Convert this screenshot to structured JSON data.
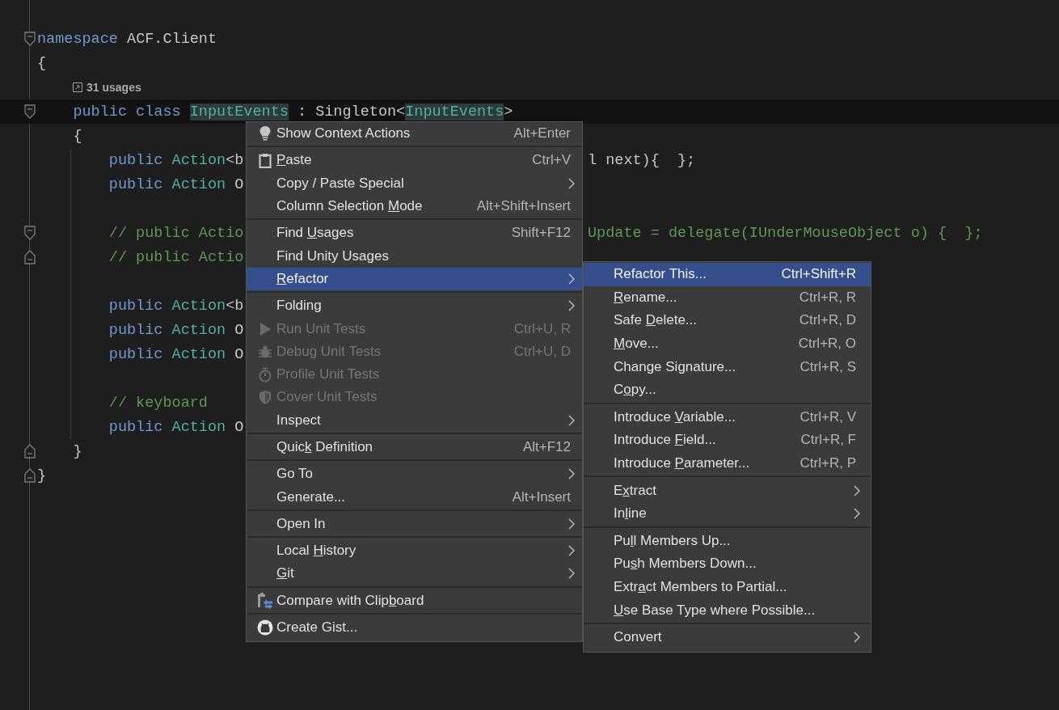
{
  "editor": {
    "lines": [
      {
        "kind": "code",
        "fold_start": true,
        "fold_end": false,
        "current": false,
        "left": [
          {
            "t": "namespace",
            "kind": "keyword"
          },
          {
            "t": " ACF.Client",
            "kind": "plain"
          }
        ]
      },
      {
        "kind": "code",
        "fold_start": false,
        "fold_end": false,
        "current": false,
        "left": [
          {
            "t": "{",
            "kind": "plain"
          }
        ]
      },
      {
        "kind": "lens",
        "text": "31 usages"
      },
      {
        "kind": "code",
        "fold_start": true,
        "fold_end": false,
        "current": true,
        "left": [
          {
            "t": "    public class ",
            "kind": "keyword"
          },
          {
            "t": "InputEvents",
            "kind": "type-highlight"
          },
          {
            "t": " : Singleton<",
            "kind": "plain"
          },
          {
            "t": "InputEvents",
            "kind": "type-highlight"
          },
          {
            "t": ">",
            "kind": "plain"
          }
        ]
      },
      {
        "kind": "code",
        "fold_start": false,
        "fold_end": false,
        "current": false,
        "left": [
          {
            "t": "    {",
            "kind": "plain"
          }
        ]
      },
      {
        "kind": "code",
        "fold_start": false,
        "fold_end": false,
        "current": false,
        "left": [
          {
            "t": "        public ",
            "kind": "keyword"
          },
          {
            "t": "Action",
            "kind": "type"
          },
          {
            "t": "<b",
            "kind": "plain"
          }
        ],
        "right": [
          {
            "t": "l next){  };",
            "kind": "plain"
          }
        ]
      },
      {
        "kind": "code",
        "fold_start": false,
        "fold_end": false,
        "current": false,
        "left": [
          {
            "t": "        public ",
            "kind": "keyword"
          },
          {
            "t": "Action",
            "kind": "type"
          },
          {
            "t": " O",
            "kind": "plain"
          }
        ]
      },
      {
        "kind": "blank"
      },
      {
        "kind": "code",
        "fold_start": true,
        "fold_end": false,
        "current": false,
        "left": [
          {
            "t": "        // public Actio",
            "kind": "comment"
          }
        ],
        "right": [
          {
            "t": "Update = delegate(IUnderMouseObject o) {  };",
            "kind": "comment"
          }
        ]
      },
      {
        "kind": "code",
        "fold_start": false,
        "fold_end": true,
        "current": false,
        "left": [
          {
            "t": "        // public Actio",
            "kind": "comment"
          }
        ]
      },
      {
        "kind": "blank"
      },
      {
        "kind": "code",
        "fold_start": false,
        "fold_end": false,
        "current": false,
        "left": [
          {
            "t": "        public ",
            "kind": "keyword"
          },
          {
            "t": "Action",
            "kind": "type"
          },
          {
            "t": "<b",
            "kind": "plain"
          }
        ]
      },
      {
        "kind": "code",
        "fold_start": false,
        "fold_end": false,
        "current": false,
        "left": [
          {
            "t": "        public ",
            "kind": "keyword"
          },
          {
            "t": "Action",
            "kind": "type"
          },
          {
            "t": " O",
            "kind": "plain"
          }
        ]
      },
      {
        "kind": "code",
        "fold_start": false,
        "fold_end": false,
        "current": false,
        "left": [
          {
            "t": "        public ",
            "kind": "keyword"
          },
          {
            "t": "Action",
            "kind": "type"
          },
          {
            "t": " O",
            "kind": "plain"
          }
        ]
      },
      {
        "kind": "blank"
      },
      {
        "kind": "code",
        "fold_start": false,
        "fold_end": false,
        "current": false,
        "left": [
          {
            "t": "        // keyboard",
            "kind": "comment"
          }
        ]
      },
      {
        "kind": "code",
        "fold_start": false,
        "fold_end": false,
        "current": false,
        "left": [
          {
            "t": "        public ",
            "kind": "keyword"
          },
          {
            "t": "Action",
            "kind": "type"
          },
          {
            "t": " O",
            "kind": "plain"
          }
        ]
      },
      {
        "kind": "code",
        "fold_start": false,
        "fold_end": true,
        "current": false,
        "left": [
          {
            "t": "    }",
            "kind": "plain"
          }
        ]
      },
      {
        "kind": "code",
        "fold_start": false,
        "fold_end": true,
        "current": false,
        "left": [
          {
            "t": "}",
            "kind": "plain"
          }
        ]
      }
    ]
  },
  "context_menu": {
    "groups": [
      [
        {
          "label": "Show Context Actions",
          "shortcut": "Alt+Enter",
          "has_submenu": false,
          "disabled": false,
          "selected": false
        }
      ],
      [
        {
          "mnemonic": "P",
          "label_after": "aste",
          "shortcut": "Ctrl+V",
          "has_submenu": false,
          "disabled": false,
          "selected": false
        },
        {
          "label": "Copy / Paste Special",
          "has_submenu": true,
          "disabled": false,
          "selected": false
        },
        {
          "label_before": "Column Selection ",
          "mnemonic": "M",
          "label_after": "ode",
          "shortcut": "Alt+Shift+Insert",
          "has_submenu": false,
          "disabled": false,
          "selected": false
        }
      ],
      [
        {
          "label_before": "Find ",
          "mnemonic": "U",
          "label_after": "sages",
          "shortcut": "Shift+F12",
          "has_submenu": false,
          "disabled": false,
          "selected": false
        },
        {
          "label": "Find Unity Usages",
          "has_submenu": false,
          "disabled": false,
          "selected": false
        },
        {
          "mnemonic": "R",
          "label_after": "efactor",
          "has_submenu": true,
          "disabled": false,
          "selected": true
        }
      ],
      [
        {
          "label": "Folding",
          "has_submenu": true,
          "disabled": false,
          "selected": false
        },
        {
          "label": "Run Unit Tests",
          "shortcut": "Ctrl+U, R",
          "has_submenu": false,
          "disabled": true,
          "selected": false
        },
        {
          "label": "Debug Unit Tests",
          "shortcut": "Ctrl+U, D",
          "has_submenu": false,
          "disabled": true,
          "selected": false
        },
        {
          "label": "Profile Unit Tests",
          "has_submenu": false,
          "disabled": true,
          "selected": false
        },
        {
          "label": "Cover Unit Tests",
          "has_submenu": false,
          "disabled": true,
          "selected": false
        },
        {
          "label": "Inspect",
          "has_submenu": true,
          "disabled": false,
          "selected": false
        }
      ],
      [
        {
          "label_before": "Quic",
          "mnemonic": "k",
          "label_after": " Definition",
          "shortcut": "Alt+F12",
          "has_submenu": false,
          "disabled": false,
          "selected": false
        }
      ],
      [
        {
          "label": "Go To",
          "has_submenu": true,
          "disabled": false,
          "selected": false
        },
        {
          "label": "Generate...",
          "shortcut": "Alt+Insert",
          "has_submenu": false,
          "disabled": false,
          "selected": false
        }
      ],
      [
        {
          "label": "Open In",
          "has_submenu": true,
          "disabled": false,
          "selected": false
        }
      ],
      [
        {
          "label_before": "Local ",
          "mnemonic": "H",
          "label_after": "istory",
          "has_submenu": true,
          "disabled": false,
          "selected": false
        },
        {
          "mnemonic": "G",
          "label_after": "it",
          "has_submenu": true,
          "disabled": false,
          "selected": false
        }
      ],
      [
        {
          "label_before": "Compare with Clip",
          "mnemonic": "b",
          "label_after": "oard",
          "has_submenu": false,
          "disabled": false,
          "selected": false
        }
      ],
      [
        {
          "label": "Create Gist...",
          "has_submenu": false,
          "disabled": false,
          "selected": false
        }
      ]
    ]
  },
  "refactor_submenu": {
    "groups": [
      [
        {
          "label": "Refactor This...",
          "shortcut": "Ctrl+Shift+R",
          "has_submenu": false,
          "selected": true
        },
        {
          "mnemonic": "R",
          "label_after": "ename...",
          "shortcut": "Ctrl+R, R",
          "has_submenu": false,
          "selected": false
        },
        {
          "label_before": "Safe ",
          "mnemonic": "D",
          "label_after": "elete...",
          "shortcut": "Ctrl+R, D",
          "has_submenu": false,
          "selected": false
        },
        {
          "mnemonic": "M",
          "label_after": "ove...",
          "shortcut": "Ctrl+R, O",
          "has_submenu": false,
          "selected": false
        },
        {
          "label_before": "Change Si",
          "mnemonic": "g",
          "label_after": "nature...",
          "shortcut": "Ctrl+R, S",
          "has_submenu": false,
          "selected": false
        },
        {
          "label_before": "C",
          "mnemonic": "o",
          "label_after": "py...",
          "has_submenu": false,
          "selected": false
        }
      ],
      [
        {
          "label_before": "Introduce ",
          "mnemonic": "V",
          "label_after": "ariable...",
          "shortcut": "Ctrl+R, V",
          "has_submenu": false,
          "selected": false
        },
        {
          "label_before": "Introduce ",
          "mnemonic": "F",
          "label_after": "ield...",
          "shortcut": "Ctrl+R, F",
          "has_submenu": false,
          "selected": false
        },
        {
          "label_before": "Introduce ",
          "mnemonic": "P",
          "label_after": "arameter...",
          "shortcut": "Ctrl+R, P",
          "has_submenu": false,
          "selected": false
        }
      ],
      [
        {
          "label_before": "E",
          "mnemonic": "x",
          "label_after": "tract",
          "has_submenu": true,
          "selected": false
        },
        {
          "label_before": "In",
          "mnemonic": "l",
          "label_after": "ine",
          "has_submenu": true,
          "selected": false
        }
      ],
      [
        {
          "label_before": "Pu",
          "mnemonic": "l",
          "label_after": "l Members Up...",
          "has_submenu": false,
          "selected": false
        },
        {
          "label_before": "Pu",
          "mnemonic": "s",
          "label_after": "h Members Down...",
          "has_submenu": false,
          "selected": false
        },
        {
          "label_before": "Extr",
          "mnemonic": "a",
          "label_after": "ct Members to Partial...",
          "has_submenu": false,
          "selected": false
        },
        {
          "mnemonic": "U",
          "label_after": "se Base Type where Possible...",
          "has_submenu": false,
          "selected": false
        }
      ],
      [
        {
          "label": "Convert",
          "has_submenu": true,
          "selected": false
        }
      ]
    ]
  }
}
